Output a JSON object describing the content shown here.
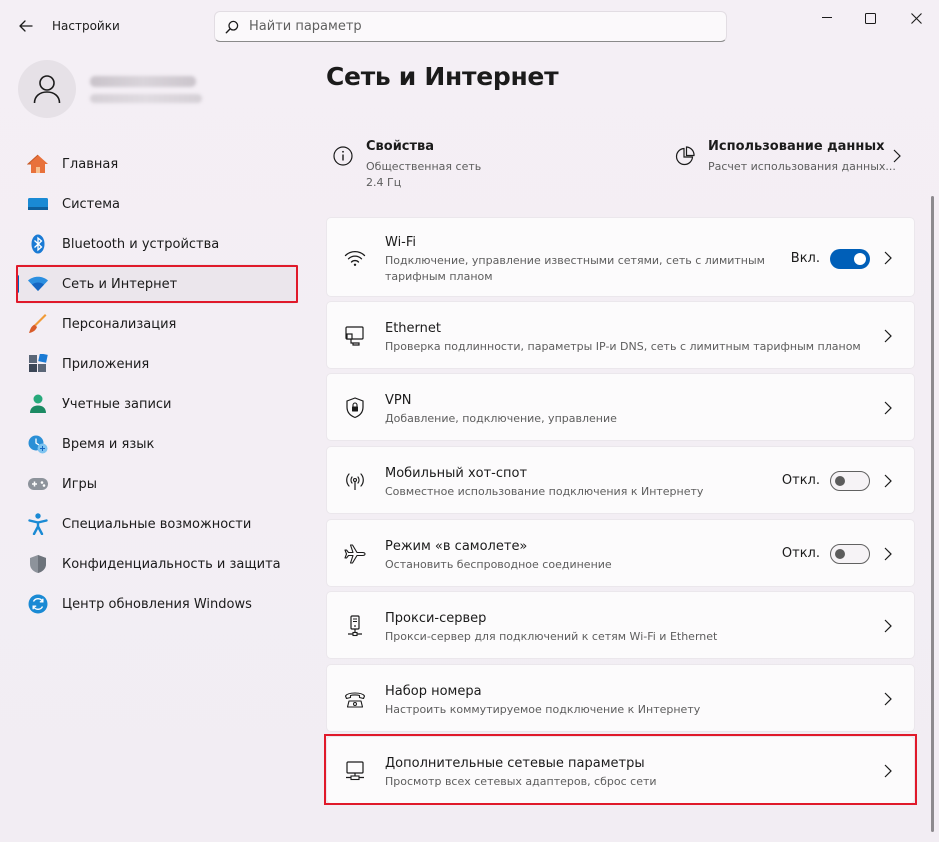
{
  "window": {
    "title": "Настройки",
    "search_placeholder": "Найти параметр"
  },
  "colors": {
    "accent": "#005fb8",
    "highlight_border": "#e0192a",
    "page_bg": "#f3eef4",
    "card_bg": "#fcfbfc"
  },
  "sidebar": {
    "items": [
      {
        "label": "Главная",
        "icon": "home-icon"
      },
      {
        "label": "Система",
        "icon": "system-monitor-icon"
      },
      {
        "label": "Bluetooth и устройства",
        "icon": "bluetooth-icon"
      },
      {
        "label": "Сеть и Интернет",
        "icon": "wifi-network-icon",
        "active": true
      },
      {
        "label": "Персонализация",
        "icon": "paint-brush-icon"
      },
      {
        "label": "Приложения",
        "icon": "apps-icon"
      },
      {
        "label": "Учетные записи",
        "icon": "account-icon"
      },
      {
        "label": "Время и язык",
        "icon": "time-language-icon"
      },
      {
        "label": "Игры",
        "icon": "gamepad-icon"
      },
      {
        "label": "Специальные возможности",
        "icon": "accessibility-icon"
      },
      {
        "label": "Конфиденциальность и защита",
        "icon": "shield-icon"
      },
      {
        "label": "Центр обновления Windows",
        "icon": "windows-update-icon"
      }
    ]
  },
  "main": {
    "title": "Сеть и Интернет",
    "properties": {
      "title": "Свойства",
      "line1": "Общественная сеть",
      "line2": "2.4 Гц"
    },
    "data_usage": {
      "title": "Использование данных",
      "subtitle": "Расчет использования данных..."
    },
    "cards": [
      {
        "title": "Wi-Fi",
        "subtitle": "Подключение, управление известными сетями, сеть с лимитным тарифным планом",
        "toggle_label": "Вкл.",
        "toggle_on": true,
        "icon": "wifi-icon"
      },
      {
        "title": "Ethernet",
        "subtitle": "Проверка подлинности, параметры IP-и DNS, сеть с лимитным тарифным планом",
        "icon": "ethernet-icon"
      },
      {
        "title": "VPN",
        "subtitle": "Добавление, подключение, управление",
        "icon": "vpn-shield-icon"
      },
      {
        "title": "Мобильный хот-спот",
        "subtitle": "Совместное использование подключения к Интернету",
        "toggle_label": "Откл.",
        "toggle_on": false,
        "icon": "hotspot-icon"
      },
      {
        "title": "Режим «в самолете»",
        "subtitle": "Остановить беспроводное соединение",
        "toggle_label": "Откл.",
        "toggle_on": false,
        "icon": "airplane-icon"
      },
      {
        "title": "Прокси-сервер",
        "subtitle": "Прокси-сервер для подключений к сетям Wi-Fi и Ethernet",
        "icon": "proxy-icon"
      },
      {
        "title": "Набор номера",
        "subtitle": "Настроить коммутируемое подключение к Интернету",
        "icon": "dialup-phone-icon"
      },
      {
        "title": "Дополнительные сетевые параметры",
        "subtitle": "Просмотр всех сетевых адаптеров, сброс сети",
        "icon": "advanced-network-icon"
      }
    ]
  }
}
